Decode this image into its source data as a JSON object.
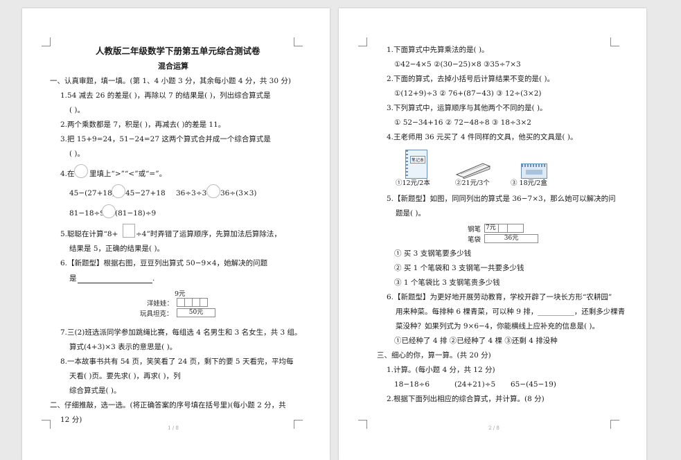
{
  "page1": {
    "title": "人教版二年级数学下册第五单元综合测试卷",
    "subtitle": "混合运算",
    "sec1": "一、认真审题，填一填。(第 1、4 小题 3 分，其余每小题 4 分，共 30 分)",
    "q1a": "1.54 减去 26 的差是(      )，再除以 7 的结果是(      )，列出综合算式是",
    "q1b": "(                   )。",
    "q2": "2.两个乘数都是 7，积是(       )，再减去(       )的差是 11。",
    "q3a": "3.把 15+9=24，51−24=27 这两个算式合并成一个综合算式是",
    "q3b": "(                   )。",
    "q4a_pre": "4.在",
    "q4a_post": "里填上“>”“<”或“=”。",
    "q4_r1a": "45−(27+18)",
    "q4_r1b": "45−27+18",
    "q4_r1c": "36÷3÷3",
    "q4_r1d": "36÷(3×3)",
    "q4_r2a": "81−18÷9",
    "q4_r2b": "(81−18)÷9",
    "q5a_pre": "5.聪聪在计算“8+",
    "q5a_post": "÷4”时弄错了运算顺序，先算加法后算除法，",
    "q5b": "结果是 5，正确的结果是(      )。",
    "q6a": "6.【新题型】根据右图，豆豆列出算式 50−9×4，她解决的问题",
    "q6b": "是",
    "q6_price": "9元",
    "q6_doll": "洋娃娃：",
    "q6_tank": "玩具坦克：",
    "q6_total": "50元",
    "q7a": "7.三(2)班选派同学参加跳绳比赛，每组选 4 名男生和 3 名女生，共 3 组。",
    "q7b": "算式(4+3)×3 表示的意思是(           )。",
    "q8a": "8.一本故事书共有 54 页，笑笑看了 24 页，剩下的要 5 天看完，平均每",
    "q8b": "天看(           )页。要先求(              )，再求(                  )，列",
    "q8c": "综合算式是(                         )。",
    "sec2a": "二、仔细推敲，选一选。(将正确答案的序号填在括号里)(每小题 2 分，共",
    "sec2b": "12 分)",
    "footer": "1 / 8"
  },
  "page2": {
    "q1": "1.下面算式中先算乘法的是(      )。",
    "q1_opts": "①42−4×5          ②(30−25)×8     ③35÷7×3",
    "q2": "2.下面的算式，去掉小括号后计算结果不变的是(      )。",
    "q2_opts": "①(12+9)÷3        ② 76+(87−43)   ③ 12÷(3×2)",
    "q3": "3.下列算式中，运算顺序与其他两个不同的是(      )。",
    "q3_opts": "① 52−34+16       ② 72−48÷8      ③ 18÷3×2",
    "q4": "4.王老师用 36 元买了 4 件同样的文具，他买的文具是(      )。",
    "q4_notebook": "笔记本",
    "q4_opt1": "①12元/2本",
    "q4_opt2": "②21元/3个",
    "q4_opt3": "③ 18元/2盒",
    "q5a": "5.【新题型】如图，同同列出的算式是 36−7×3，那么她可以解决的问",
    "q5b": "题是(      )。",
    "q5_pen": "钢笔",
    "q5_pen_price": "7元",
    "q5_case": "笔袋",
    "q5_case_price": "36元",
    "q5_o1": "① 买 3 支钢笔要多少钱",
    "q5_o2": "② 买 1 个笔袋和 3 支钢笔一共要多少钱",
    "q5_o3": "③ 1 个笔袋比 3 支钢笔贵多少钱",
    "q6a": "6.【新题型】为更好地开展劳动教育，学校开辟了一块长方形“农耕园”",
    "q6b": "用来种菜。每排种 6 棵青菜，可以种 9 排，__________，还剩多少棵青",
    "q6c": "菜没种？如果列式为 9×6−4，你能横线上应补充的信息是(      )。",
    "q6_opts": "①已经种了 4 排   ②已经种了 4 棵  ③还剩 4 排没种",
    "sec3": "三、细心的你，算一算。(共 20 分)",
    "c1": "1.计算。(每小题 4 分，共 12 分)",
    "c1_a": "18−18÷6",
    "c1_b": "(24+21)÷5",
    "c1_c": "65−(45−19)",
    "c2": "2.根据下面列出相应的综合算式，并计算。(8 分)",
    "footer": "2 / 8"
  }
}
